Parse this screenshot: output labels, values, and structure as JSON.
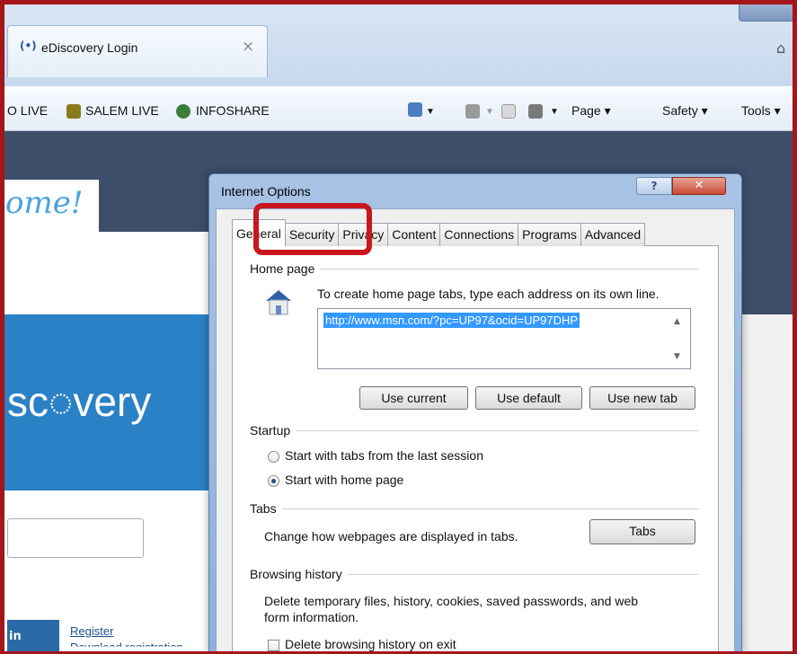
{
  "browser": {
    "tab_icon": "(•)",
    "tab_title": "eDiscovery Login",
    "tab_close": "×",
    "favorites": [
      {
        "label": "O LIVE",
        "icon": "favorite-icon"
      },
      {
        "label": "SALEM LIVE",
        "icon": "bug-icon"
      },
      {
        "label": "INFOSHARE",
        "icon": "globe-icon"
      }
    ],
    "commands": {
      "page": "Page ▾",
      "safety": "Safety ▾",
      "tools": "Tools ▾"
    }
  },
  "page": {
    "welcome": "ome!",
    "logo": "sc◌very",
    "login_btn": "in",
    "register": "Register",
    "download": "Download registration"
  },
  "dialog": {
    "title": "Internet Options",
    "help": "?",
    "close": "✕",
    "tabs": [
      "General",
      "Security",
      "Privacy",
      "Content",
      "Connections",
      "Programs",
      "Advanced"
    ],
    "home_page": {
      "label": "Home page",
      "instruction": "To create home page tabs, type each address on its own line.",
      "url": "http://www.msn.com/?pc=UP97&ocid=UP97DHP",
      "buttons": {
        "use_current": "Use current",
        "use_default": "Use default",
        "use_new_tab": "Use new tab"
      }
    },
    "startup": {
      "label": "Startup",
      "option1": "Start with tabs from the last session",
      "option2": "Start with home page",
      "selected": "Start with home page"
    },
    "tabs_section": {
      "label": "Tabs",
      "description": "Change how webpages are displayed in tabs.",
      "button": "Tabs"
    },
    "browsing_history": {
      "label": "Browsing history",
      "description_line1": "Delete temporary files, history, cookies, saved passwords, and web",
      "description_line2": "form information.",
      "checkbox": "Delete browsing history on exit"
    }
  },
  "colors": {
    "highlight": "#c9171d",
    "frame": "#a4161a",
    "page_dark": "#3d4e6a",
    "brand_blue": "#2b81c5"
  }
}
